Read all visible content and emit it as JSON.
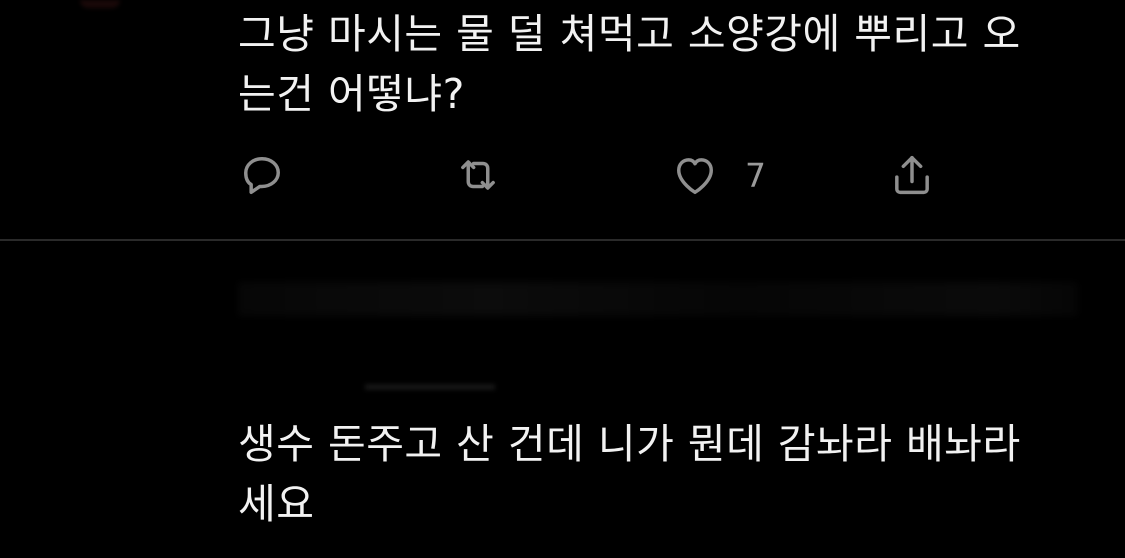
{
  "tweet1": {
    "lines": [
      "그냥 마시는 물 덜 쳐먹고 소양강에 뿌리고 오",
      "는건 어떻냐?"
    ],
    "actions": {
      "reply_icon": "reply-icon",
      "retweet_icon": "retweet-icon",
      "like_icon": "heart-icon",
      "like_count": "7",
      "share_icon": "share-icon"
    }
  },
  "tweet2": {
    "lines": [
      "생수 돈주고 산 건데 니가 뭔데 감놔라 배놔라",
      "세요"
    ]
  },
  "colors": {
    "background": "#000000",
    "text": "#f2f2f2",
    "icon": "#8f8f8f",
    "divider": "#2a2a2a"
  }
}
